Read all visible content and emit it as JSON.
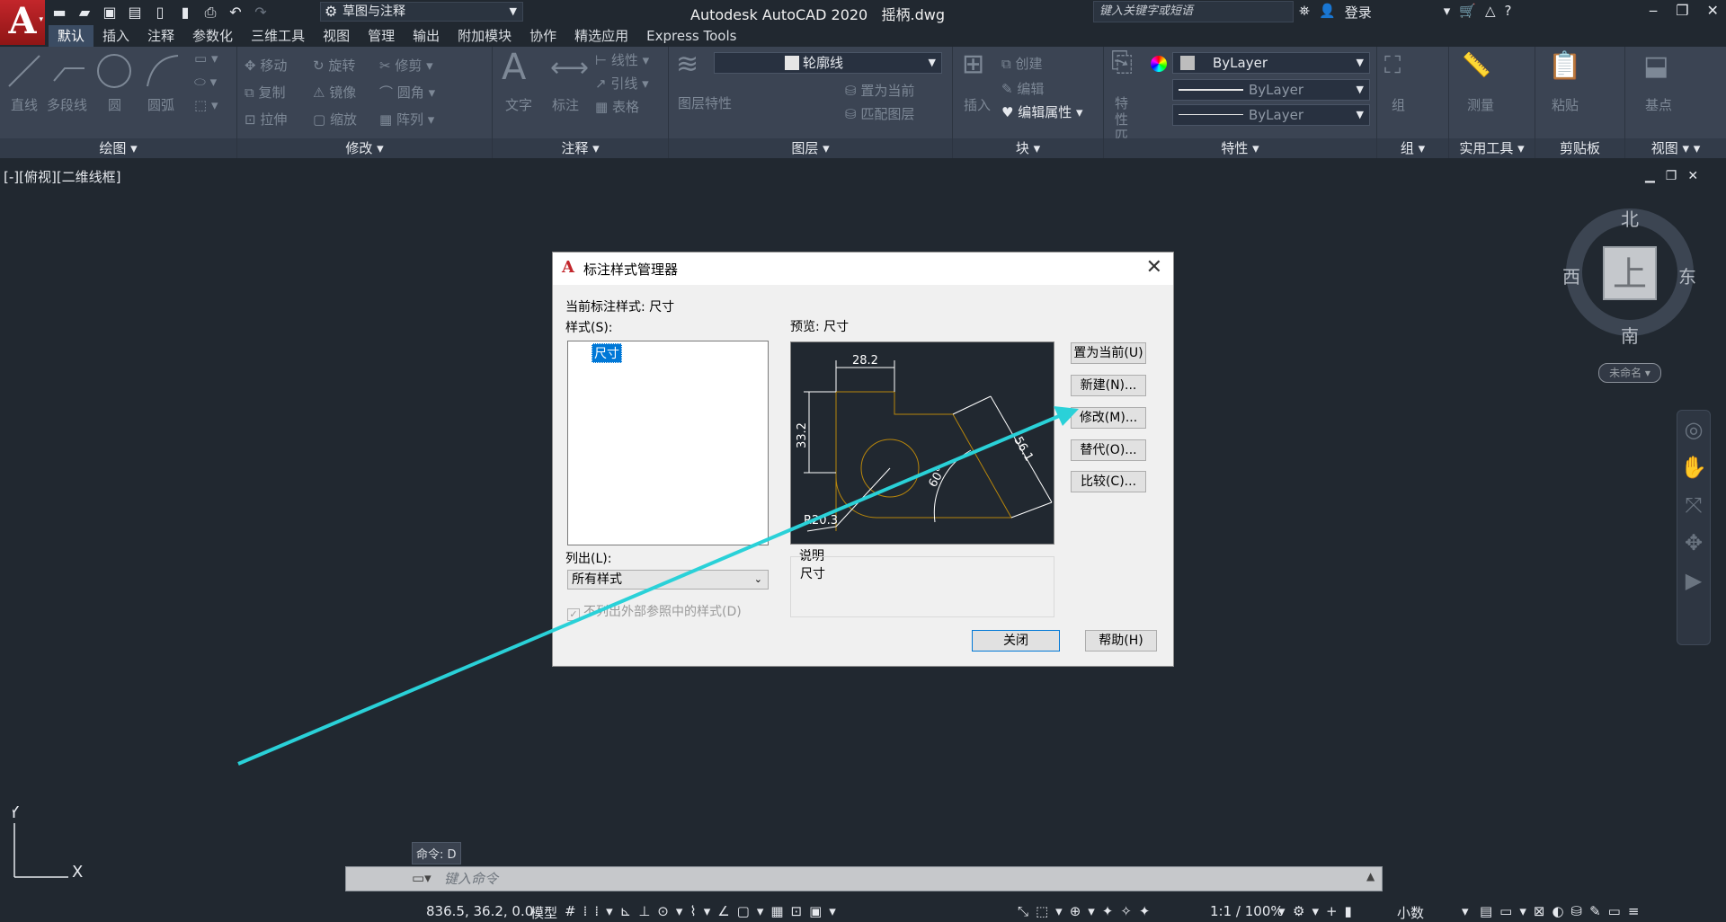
{
  "app": {
    "logo": "A",
    "app_title": "Autodesk AutoCAD 2020",
    "file_name": "摇柄.dwg",
    "workspace": "草图与注释",
    "search_placeholder": "键入关键字或短语",
    "login": "登录"
  },
  "ribbon": {
    "tabs": [
      "默认",
      "插入",
      "注释",
      "参数化",
      "三维工具",
      "视图",
      "管理",
      "输出",
      "附加模块",
      "协作",
      "精选应用",
      "Express Tools"
    ],
    "panels": {
      "draw": {
        "title": "绘图",
        "items": [
          "直线",
          "多段线",
          "圆",
          "圆弧"
        ]
      },
      "modify": {
        "title": "修改",
        "items": [
          "移动",
          "旋转",
          "修剪",
          "复制",
          "镜像",
          "圆角",
          "拉伸",
          "缩放",
          "阵列"
        ]
      },
      "annotation": {
        "title": "注释",
        "items": [
          "文字",
          "标注",
          "线性",
          "引线",
          "表格"
        ]
      },
      "layers": {
        "title": "图层",
        "layer_name": "轮廓线",
        "items": [
          "图层特性",
          "置为当前",
          "匹配图层"
        ]
      },
      "block": {
        "title": "块",
        "items": [
          "插入",
          "创建",
          "编辑",
          "编辑属性"
        ]
      },
      "properties": {
        "title": "特性",
        "items": [
          "特性匹配"
        ],
        "color": "ByLayer",
        "linetype": "ByLayer",
        "lineweight": "ByLayer"
      },
      "groups": {
        "title": "组",
        "items": [
          "组"
        ]
      },
      "utilities": {
        "title": "实用工具",
        "items": [
          "测量"
        ]
      },
      "clipboard": {
        "title": "剪贴板",
        "items": [
          "粘贴"
        ]
      },
      "view": {
        "title": "视图",
        "items": [
          "基点"
        ]
      }
    }
  },
  "viewport": {
    "label": "[-][俯视][二维线框]",
    "compass": {
      "north": "北",
      "south": "南",
      "east": "东",
      "west": "西",
      "top": "上"
    },
    "unnamed": "未命名",
    "ucs_x": "X",
    "ucs_y": "Y"
  },
  "dialog": {
    "title": "标注样式管理器",
    "current_style_label": "当前标注样式: 尺寸",
    "styles_label": "样式(S):",
    "styles": [
      "尺寸"
    ],
    "preview_label": "预览: 尺寸",
    "list_label": "列出(L):",
    "list_value": "所有样式",
    "checkbox_label": "不列出外部参照中的样式(D)",
    "description_label": "说明",
    "description_value": "尺寸",
    "buttons": {
      "set_current": "置为当前(U)",
      "new": "新建(N)...",
      "modify": "修改(M)...",
      "override": "替代(O)...",
      "compare": "比较(C)...",
      "close": "关闭",
      "help": "帮助(H)"
    },
    "preview_dims": {
      "d1": "28.2",
      "d2": "33.2",
      "d3": "60°",
      "d4": "R20.3",
      "d5": "56.1"
    }
  },
  "command": {
    "last": "命令: D",
    "placeholder": "键入命令"
  },
  "status": {
    "coords": "836.5, 36.2, 0.0",
    "model": "模型",
    "scale": "1:1 / 100%",
    "units": "小数"
  },
  "colors": {
    "annotation_arrow": "#2ad1d8",
    "accent": "#0078d7"
  }
}
